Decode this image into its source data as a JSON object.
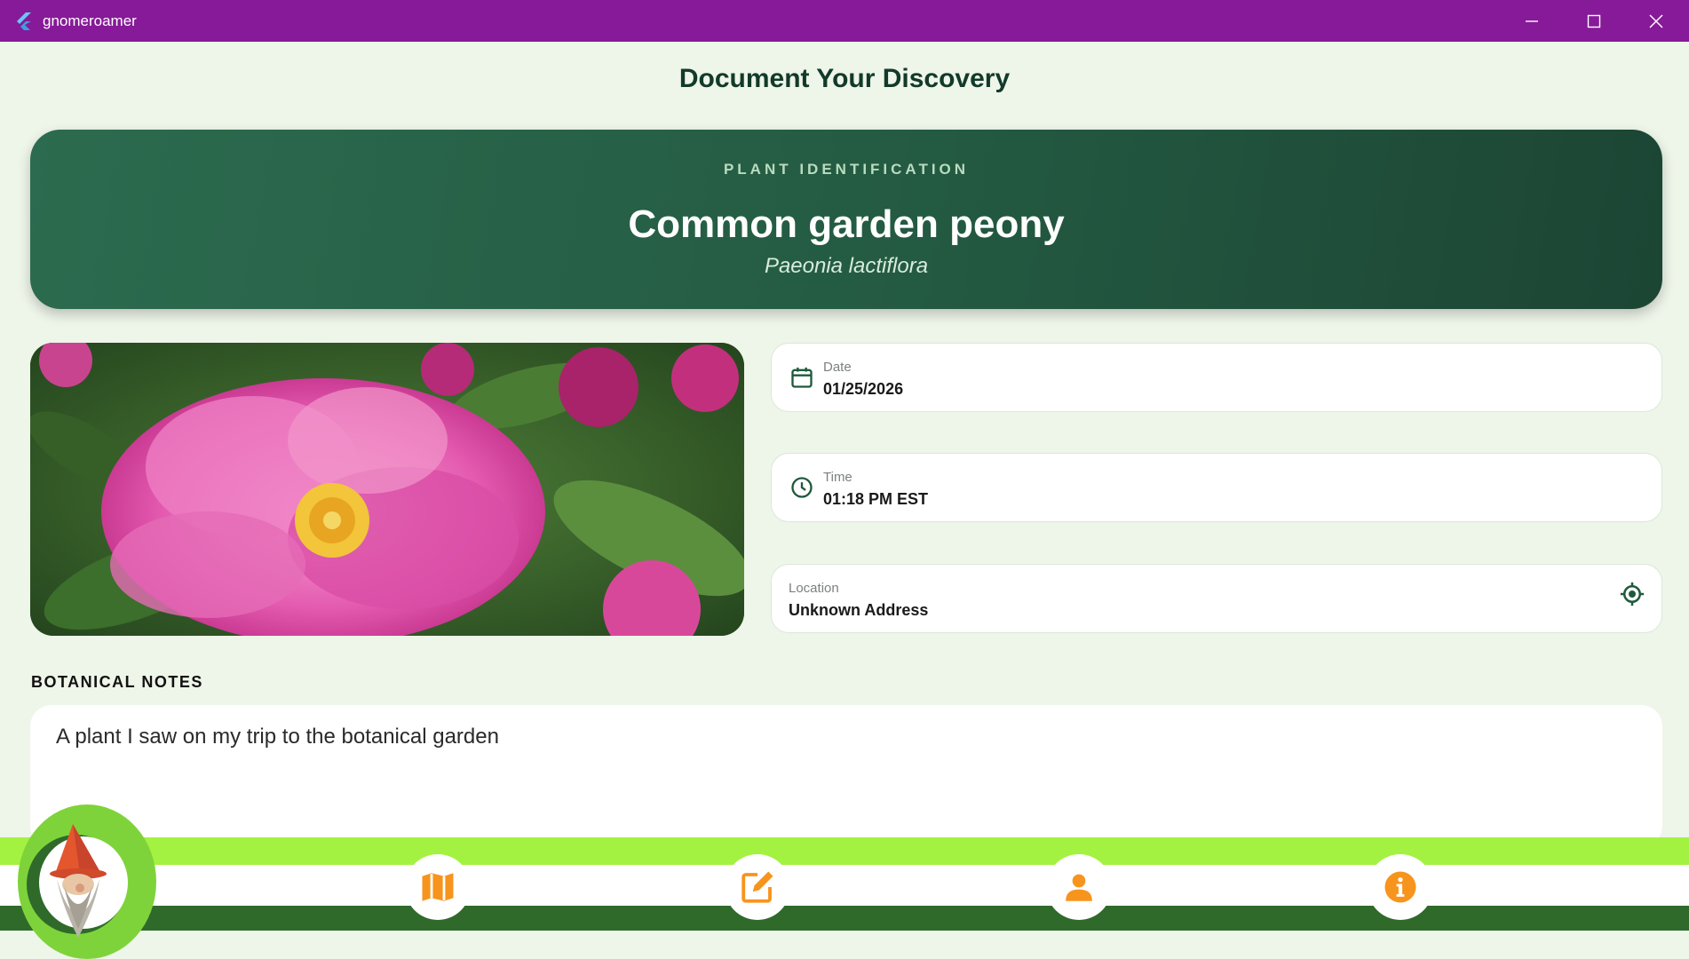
{
  "window": {
    "title": "gnomeroamer",
    "app_icon": "flutter-logo-icon",
    "controls": [
      "minimize-icon",
      "maximize-icon",
      "close-icon"
    ]
  },
  "page": {
    "title": "Document Your Discovery"
  },
  "banner": {
    "eyebrow": "PLANT IDENTIFICATION",
    "common_name": "Common garden peony",
    "scientific_name": "Paeonia lactiflora"
  },
  "photo": {
    "subject": "pink peony flower"
  },
  "fields": {
    "date": {
      "label": "Date",
      "value": "01/25/2026",
      "icon": "calendar-icon"
    },
    "time": {
      "label": "Time",
      "value": "01:18 PM EST",
      "icon": "clock-icon"
    },
    "location": {
      "label": "Location",
      "value": "Unknown Address",
      "icon": "locate-icon"
    }
  },
  "notes": {
    "label": "BOTANICAL NOTES",
    "text": "A plant I saw on my trip to the botanical garden"
  },
  "nav": {
    "items": [
      "gnome-avatar",
      "map-icon",
      "edit-icon",
      "person-icon",
      "info-icon"
    ],
    "colors": {
      "accent": "#f7941d",
      "light_green": "#a3f242",
      "dark_green": "#2f6a2b",
      "titlebar": "#861a98"
    }
  }
}
